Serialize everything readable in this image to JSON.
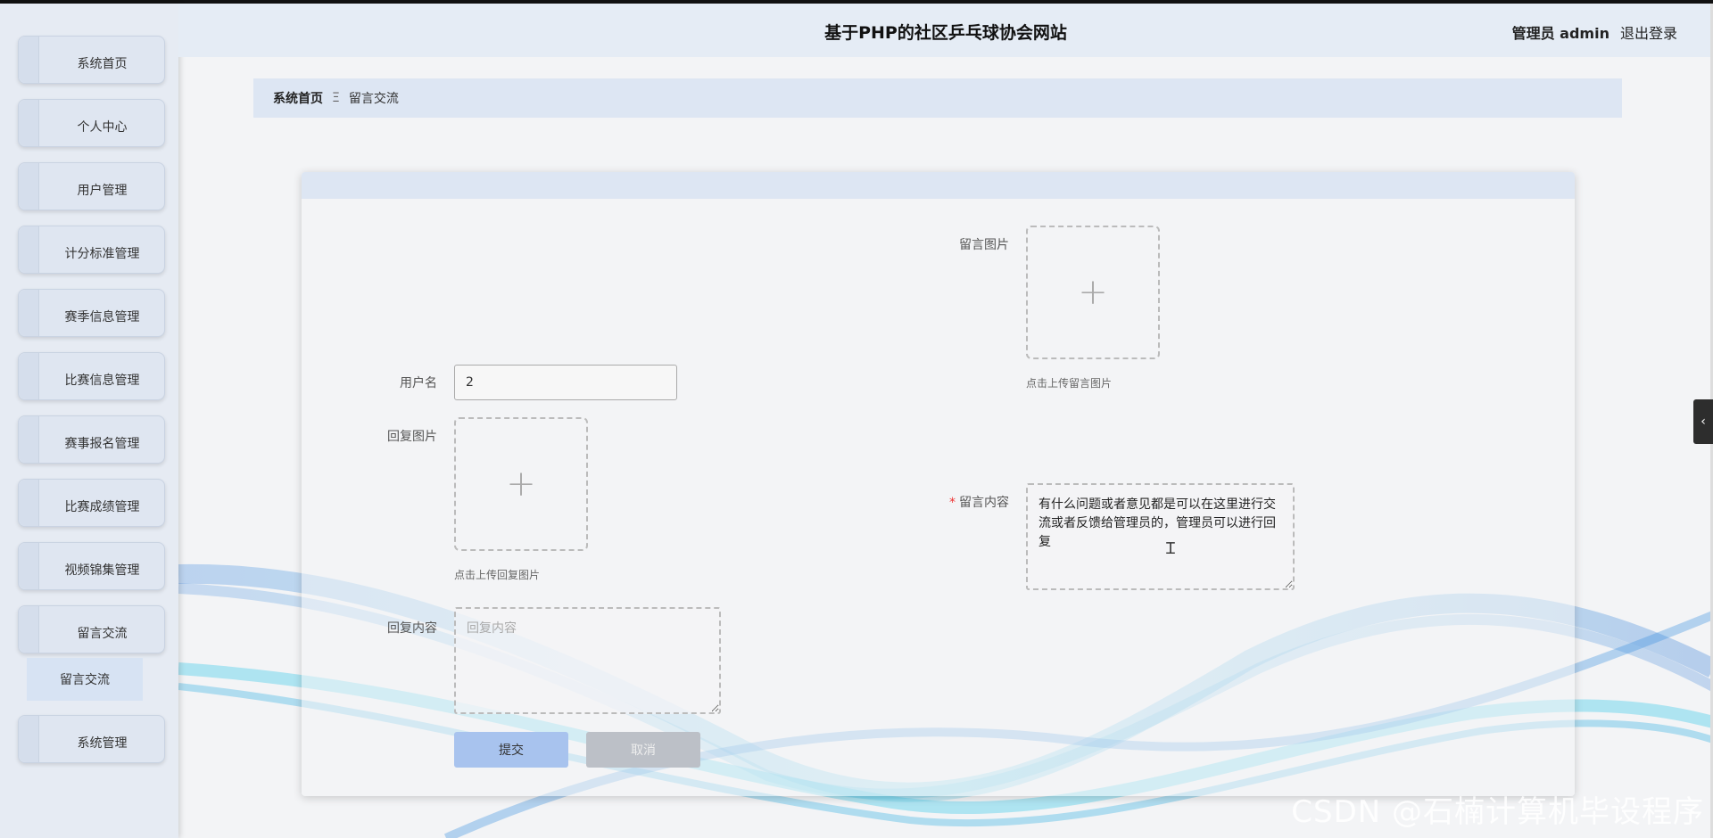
{
  "header": {
    "title": "基于PHP的社区乒乓球协会网站",
    "role": "管理员 admin",
    "logout": "退出登录"
  },
  "sidebar": {
    "items": [
      {
        "label": "系统首页"
      },
      {
        "label": "个人中心"
      },
      {
        "label": "用户管理"
      },
      {
        "label": "计分标准管理"
      },
      {
        "label": "赛季信息管理"
      },
      {
        "label": "比赛信息管理"
      },
      {
        "label": "赛事报名管理"
      },
      {
        "label": "比赛成绩管理"
      },
      {
        "label": "视频锦集管理"
      },
      {
        "label": "留言交流"
      },
      {
        "label": "系统管理"
      }
    ],
    "sub_item": "留言交流"
  },
  "breadcrumb": {
    "home": "系统首页",
    "separator": "Ξ",
    "current": "留言交流"
  },
  "form": {
    "username_label": "用户名",
    "username_value": "2",
    "reply_image_label": "回复图片",
    "reply_image_hint": "点击上传回复图片",
    "reply_content_label": "回复内容",
    "reply_content_placeholder": "回复内容",
    "message_image_label": "留言图片",
    "message_image_hint": "点击上传留言图片",
    "message_content_label": "留言内容",
    "message_content_value": "有什么问题或者意见都是可以在这里进行交流或者反馈给管理员的，管理员可以进行回复",
    "submit": "提交",
    "cancel": "取消"
  },
  "icons": {
    "upload": "plus-icon",
    "collapse": "chevron-left-icon"
  },
  "watermark": "CSDN @石楠计算机毕设程序",
  "colors": {
    "sidebar_bg": "#e6ebf3",
    "header_bg": "#e5ecf5",
    "submit_bg": "#a8c3ee",
    "cancel_bg": "#bcc0c7",
    "required": "#ee3333"
  }
}
